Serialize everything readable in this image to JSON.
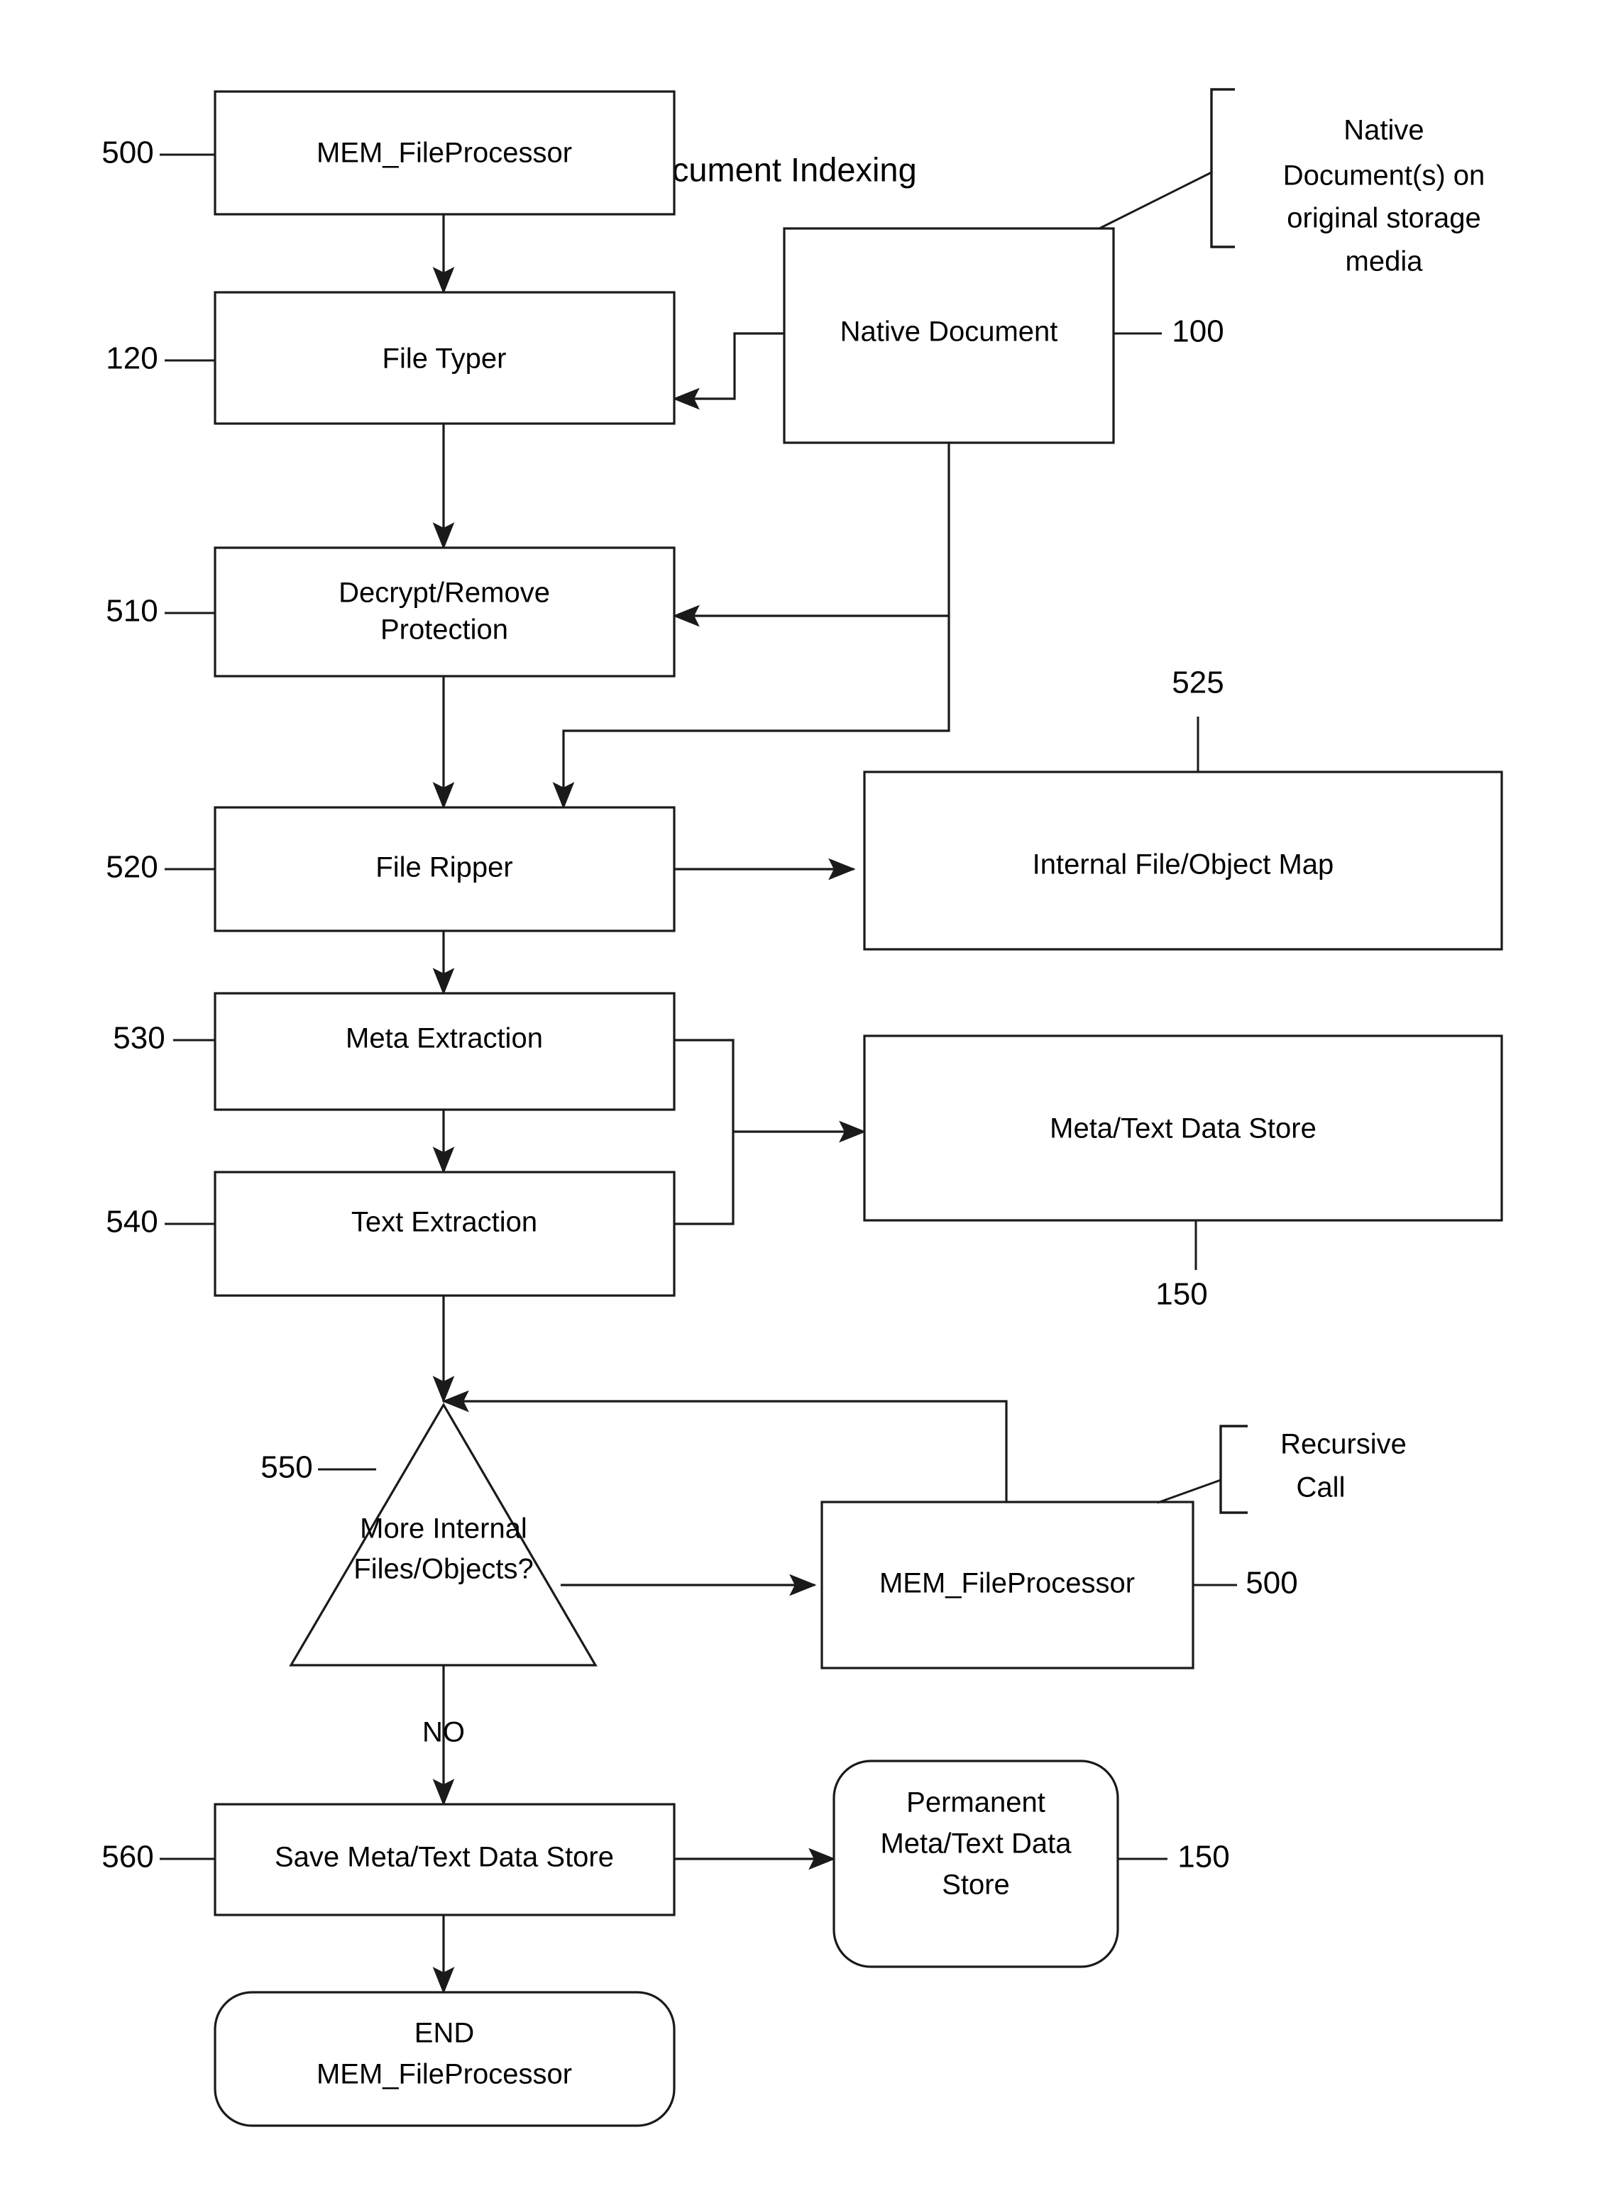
{
  "diagram": {
    "title": "Thin Document Indexing",
    "nodes": {
      "start_processor": "MEM_FileProcessor",
      "file_typer": "File Typer",
      "decrypt_line1": "Decrypt/Remove",
      "decrypt_line2": "Protection",
      "file_ripper": "File Ripper",
      "meta_extraction": "Meta Extraction",
      "text_extraction": "Text Extraction",
      "native_document": "Native Document",
      "internal_file_object_map": "Internal File/Object Map",
      "meta_text_data_store": "Meta/Text Data Store",
      "decision_line1": "More Internal",
      "decision_line2": "Files/Objects?",
      "recursive_processor": "MEM_FileProcessor",
      "save_data_store": "Save Meta/Text Data Store",
      "permanent_line1": "Permanent",
      "permanent_line2": "Meta/Text Data",
      "permanent_line3": "Store",
      "end_line1": "END",
      "end_line2": "MEM_FileProcessor"
    },
    "reference_numbers": {
      "start_processor": "500",
      "file_typer": "120",
      "decrypt": "510",
      "file_ripper": "520",
      "internal_map": "525",
      "meta_extraction": "530",
      "text_extraction": "540",
      "native_document": "100",
      "meta_text_data_store": "150",
      "decision": "550",
      "recursive_processor": "500",
      "save_data_store": "560",
      "permanent_store": "150"
    },
    "annotations": {
      "native_doc_note_line1": "Native",
      "native_doc_note_line2": "Document(s) on",
      "native_doc_note_line3": "original storage",
      "native_doc_note_line4": "media",
      "recursive_call_line1": "Recursive",
      "recursive_call_line2": "Call"
    },
    "edge_labels": {
      "decision_no": "NO"
    },
    "colors": {
      "stroke": "#1a1a1a",
      "fill": "#ffffff",
      "text": "#000000"
    }
  }
}
